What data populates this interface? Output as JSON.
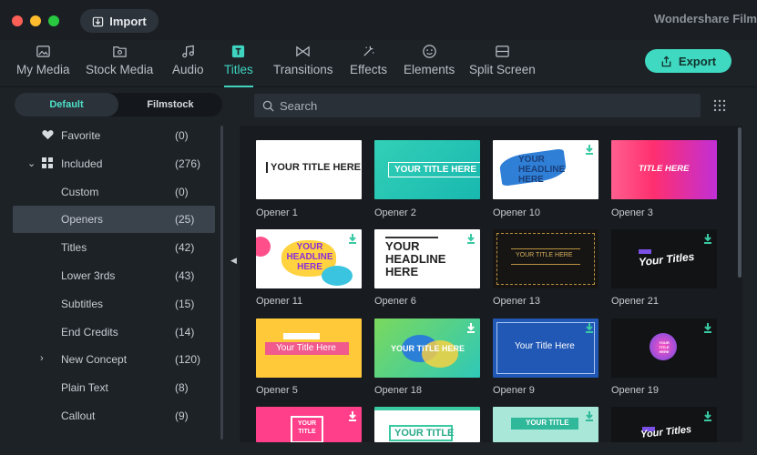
{
  "window": {
    "title": "Wondershare Film",
    "import_label": "Import"
  },
  "toolbar": {
    "tabs": [
      {
        "label": "My Media",
        "icon": "image-icon"
      },
      {
        "label": "Stock Media",
        "icon": "folder-image-icon"
      },
      {
        "label": "Audio",
        "icon": "music-note-icon"
      },
      {
        "label": "Titles",
        "icon": "text-t-icon"
      },
      {
        "label": "Transitions",
        "icon": "bowtie-icon"
      },
      {
        "label": "Effects",
        "icon": "sparkle-icon"
      },
      {
        "label": "Elements",
        "icon": "smiley-icon"
      },
      {
        "label": "Split Screen",
        "icon": "split-screen-icon"
      }
    ],
    "active_tab": "Titles",
    "export_label": "Export"
  },
  "sidebar": {
    "segments": [
      "Default",
      "Filmstock"
    ],
    "categories": [
      {
        "label": "Favorite",
        "count": "(0)"
      },
      {
        "label": "Included",
        "count": "(276)"
      },
      {
        "label": "Custom",
        "count": "(0)"
      },
      {
        "label": "Openers",
        "count": "(25)"
      },
      {
        "label": "Titles",
        "count": "(42)"
      },
      {
        "label": "Lower 3rds",
        "count": "(43)"
      },
      {
        "label": "Subtitles",
        "count": "(15)"
      },
      {
        "label": "End Credits",
        "count": "(14)"
      },
      {
        "label": "New Concept",
        "count": "(120)"
      },
      {
        "label": "Plain Text",
        "count": "(8)"
      },
      {
        "label": "Callout",
        "count": "(9)"
      }
    ]
  },
  "search": {
    "placeholder": "Search"
  },
  "thumbnails": {
    "items": [
      {
        "label": "Opener 1",
        "text": "YOUR TITLE HERE"
      },
      {
        "label": "Opener 2",
        "text": "YOUR TITLE HERE"
      },
      {
        "label": "Opener 10",
        "text": "YOUR HEADLINE HERE"
      },
      {
        "label": "Opener 3",
        "text": "TITLE HERE"
      },
      {
        "label": "Opener 11",
        "text": "YOUR HEADLINE HERE"
      },
      {
        "label": "Opener 6",
        "text": "YOUR HEADLINE HERE"
      },
      {
        "label": "Opener 13",
        "text": "YOUR TITLE HERE"
      },
      {
        "label": "Opener 21",
        "text": "Your Titles"
      },
      {
        "label": "Opener 5",
        "text": "Your Title Here"
      },
      {
        "label": "Opener 18",
        "text": "YOUR TITLE HERE"
      },
      {
        "label": "Opener 9",
        "text": "Your Title Here"
      },
      {
        "label": "Opener 19",
        "text": "YOUR TITLE HERE"
      },
      {
        "label": "",
        "text": "YOUR TITLE"
      },
      {
        "label": "",
        "text": "YOUR TITLE"
      },
      {
        "label": "",
        "text": "YOUR TITLE"
      },
      {
        "label": "",
        "text": "Your Titles"
      }
    ]
  },
  "colors": {
    "accent": "#3fd4bf",
    "export_bg": "#3fd8c0",
    "selected_row": "#3a424b"
  }
}
